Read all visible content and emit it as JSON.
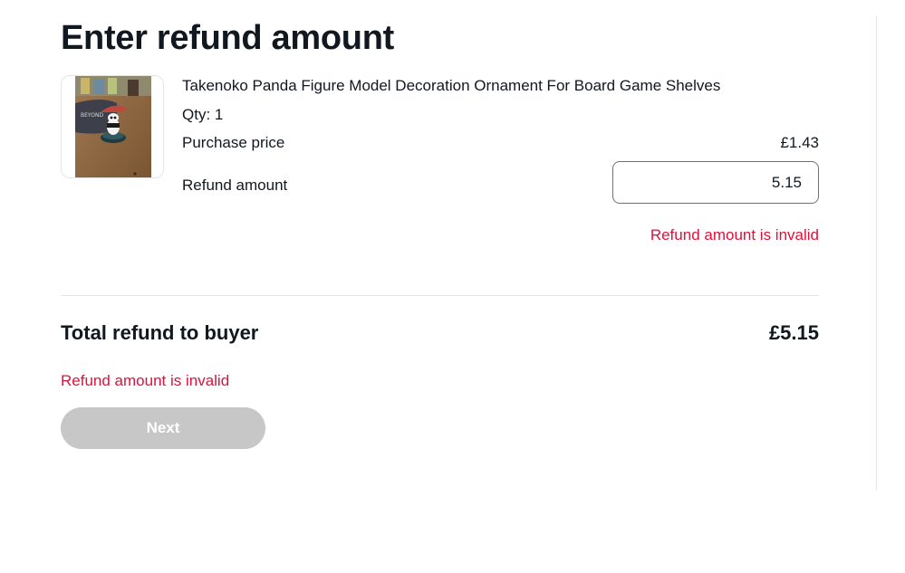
{
  "page": {
    "title": "Enter refund amount"
  },
  "item": {
    "title": "Takenoko Panda Figure Model Decoration Ornament For Board Game Shelves",
    "qty": "Qty: 1",
    "purchase_label": "Purchase price",
    "purchase_value": "£1.43",
    "refund_label": "Refund amount",
    "refund_value": "5.15",
    "refund_error": "Refund amount is invalid",
    "image_icon": "product-photo"
  },
  "total": {
    "label": "Total refund to buyer",
    "value": "£5.15"
  },
  "form_error": "Refund amount is invalid",
  "next_button": {
    "label": "Next",
    "disabled": true
  },
  "colors": {
    "error": "#e0103a",
    "button_disabled": "#c7c7c7",
    "text": "#111820",
    "divider": "#e5e5e5"
  }
}
